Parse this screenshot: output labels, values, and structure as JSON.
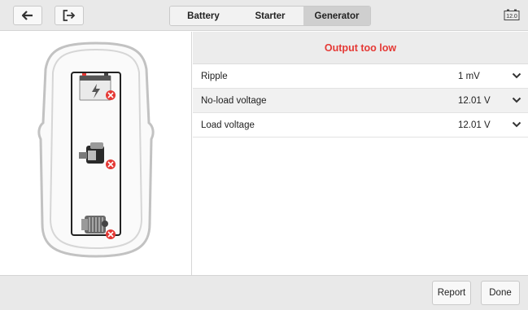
{
  "toolbar": {
    "back_icon": "arrow-left-icon",
    "exit_icon": "exit-icon",
    "battery_voltage_icon": "battery-voltage-icon",
    "battery_voltage_text": "12.0",
    "tabs": [
      {
        "label": "Battery",
        "active": false
      },
      {
        "label": "Starter",
        "active": false
      },
      {
        "label": "Generator",
        "active": true
      }
    ]
  },
  "status": {
    "text": "Output too low",
    "color": "#e53935"
  },
  "readings": [
    {
      "label": "Ripple",
      "value": "1 mV"
    },
    {
      "label": "No-load voltage",
      "value": "12.01 V"
    },
    {
      "label": "Load voltage",
      "value": "12.01 V"
    }
  ],
  "diagram": {
    "components": [
      "battery",
      "starter",
      "generator"
    ],
    "fault_icon": "error-badge-icon"
  },
  "footer": {
    "report_label": "Report",
    "done_label": "Done"
  }
}
